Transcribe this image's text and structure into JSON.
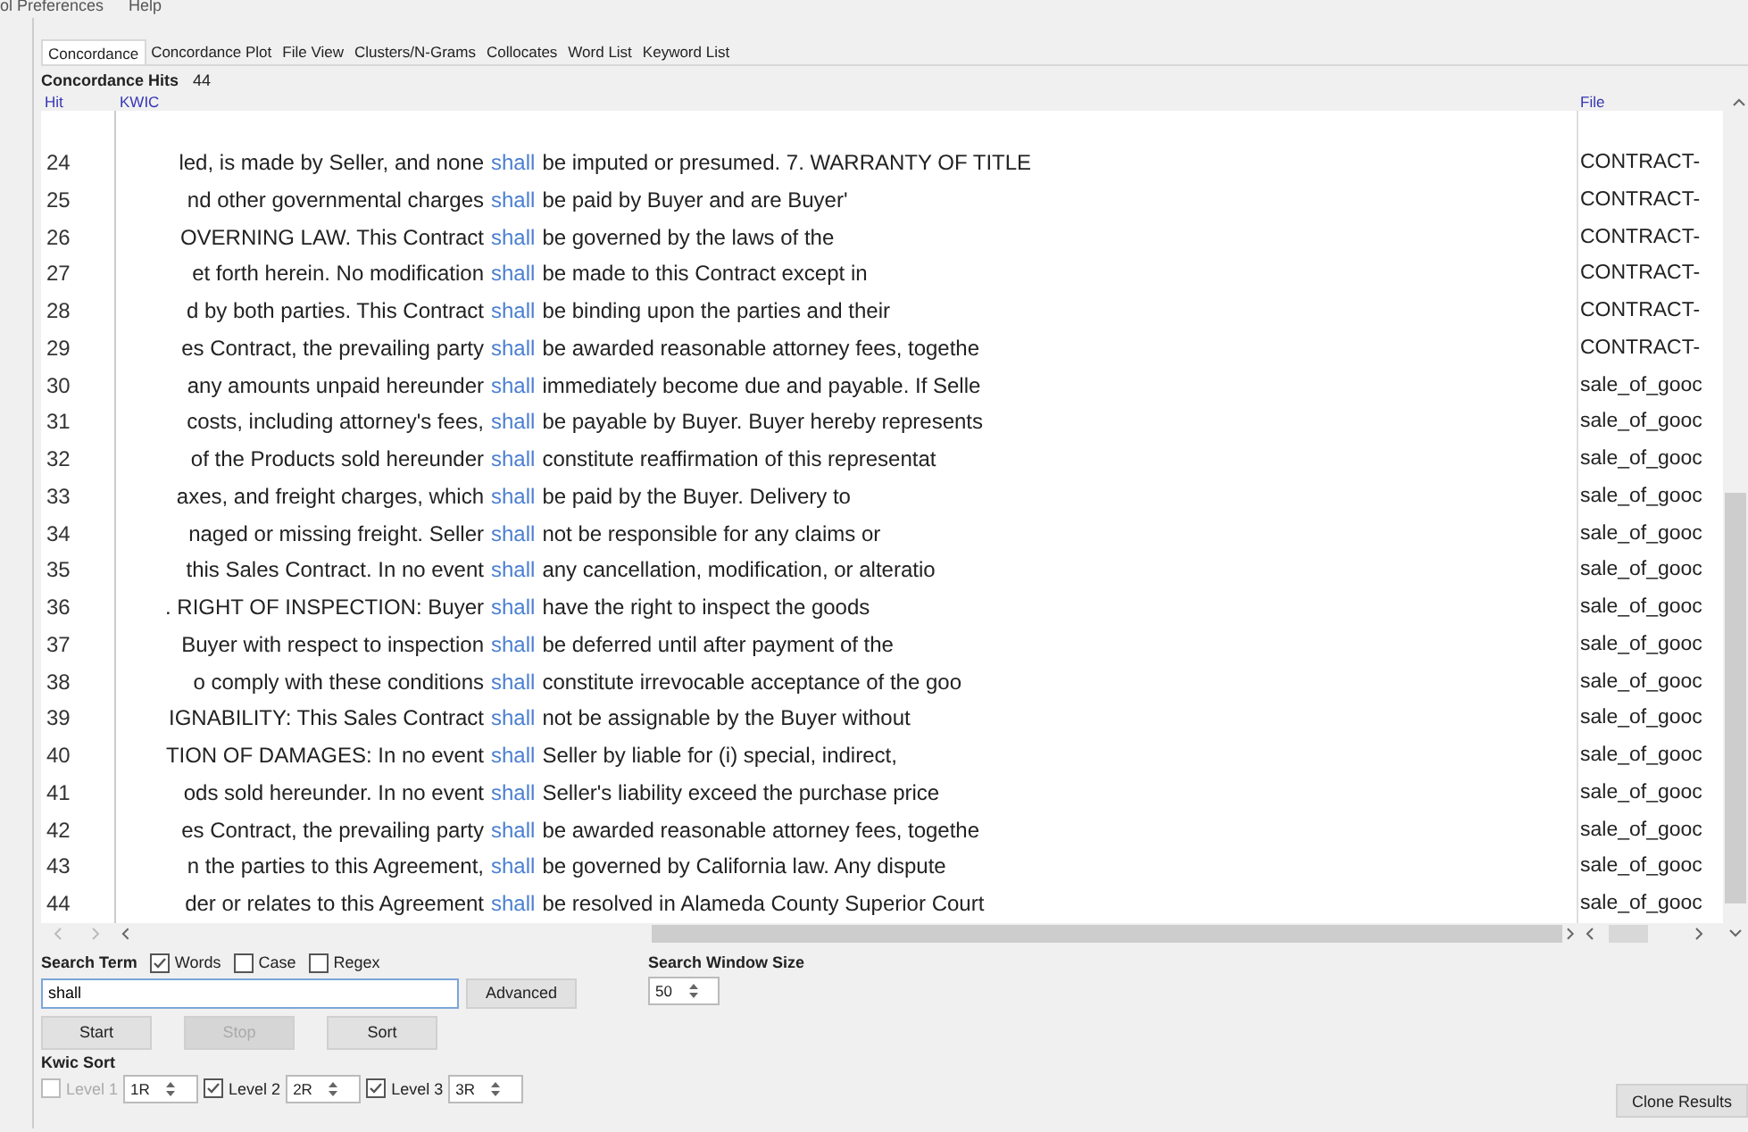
{
  "menu": [
    "ol Preferences",
    "Help"
  ],
  "tabs": [
    {
      "label": "Concordance",
      "selected": true
    },
    {
      "label": "Concordance Plot",
      "selected": false
    },
    {
      "label": "File View",
      "selected": false
    },
    {
      "label": "Clusters/N-Grams",
      "selected": false
    },
    {
      "label": "Collocates",
      "selected": false
    },
    {
      "label": "Word List",
      "selected": false
    },
    {
      "label": "Keyword List",
      "selected": false
    }
  ],
  "hits_label": "Concordance Hits",
  "hits_count": "44",
  "columns": {
    "hit": "Hit",
    "kwic": "KWIC",
    "file": "File"
  },
  "rows": [
    {
      "hit": "24",
      "left": "led, is made by Seller, and none",
      "keyword": "shall",
      "right": "be imputed or presumed. 7. WARRANTY OF TITLE",
      "file": "CONTRACT-"
    },
    {
      "hit": "25",
      "left": "nd other governmental charges",
      "keyword": "shall",
      "right": "be paid by Buyer and are Buyer'",
      "file": "CONTRACT-"
    },
    {
      "hit": "26",
      "left": "OVERNING LAW. This Contract",
      "keyword": "shall",
      "right": "be governed by the laws of the",
      "file": "CONTRACT-"
    },
    {
      "hit": "27",
      "left": "et forth herein. No modification",
      "keyword": "shall",
      "right": "be made to this Contract except in",
      "file": "CONTRACT-"
    },
    {
      "hit": "28",
      "left": "d by both parties. This Contract",
      "keyword": "shall",
      "right": "be binding upon the parties and their",
      "file": "CONTRACT-"
    },
    {
      "hit": "29",
      "left": "es Contract, the prevailing party",
      "keyword": "shall",
      "right": "be awarded reasonable attorney fees, togethe",
      "file": "CONTRACT-"
    },
    {
      "hit": "30",
      "left": "any amounts unpaid hereunder",
      "keyword": "shall",
      "right": "immediately become due and payable. If Selle",
      "file": "sale_of_gooc"
    },
    {
      "hit": "31",
      "left": "costs, including attorney's fees,",
      "keyword": "shall",
      "right": "be payable by Buyer. Buyer hereby represents",
      "file": "sale_of_gooc"
    },
    {
      "hit": "32",
      "left": "of the Products sold hereunder",
      "keyword": "shall",
      "right": "constitute reaffirmation of this representat",
      "file": "sale_of_gooc"
    },
    {
      "hit": "33",
      "left": "axes, and freight charges, which",
      "keyword": "shall",
      "right": "be paid by the Buyer. Delivery to",
      "file": "sale_of_gooc"
    },
    {
      "hit": "34",
      "left": "naged or missing freight. Seller",
      "keyword": "shall",
      "right": "not be responsible for any claims or",
      "file": "sale_of_gooc"
    },
    {
      "hit": "35",
      "left": "this Sales Contract. In no event",
      "keyword": "shall",
      "right": "any cancellation, modification, or alteratio",
      "file": "sale_of_gooc"
    },
    {
      "hit": "36",
      "left": ". RIGHT OF INSPECTION: Buyer",
      "keyword": "shall",
      "right": "have the right to inspect the goods",
      "file": "sale_of_gooc"
    },
    {
      "hit": "37",
      "left": "Buyer with respect to inspection",
      "keyword": "shall",
      "right": "be deferred until after payment of the",
      "file": "sale_of_gooc"
    },
    {
      "hit": "38",
      "left": "o comply with these conditions",
      "keyword": "shall",
      "right": "constitute irrevocable acceptance of the goo",
      "file": "sale_of_gooc"
    },
    {
      "hit": "39",
      "left": "IGNABILITY: This Sales Contract",
      "keyword": "shall",
      "right": "not be assignable by the Buyer without",
      "file": "sale_of_gooc"
    },
    {
      "hit": "40",
      "left": "TION OF DAMAGES: In no event",
      "keyword": "shall",
      "right": "Seller by liable for (i) special, indirect,",
      "file": "sale_of_gooc"
    },
    {
      "hit": "41",
      "left": "ods sold hereunder. In no event",
      "keyword": "shall",
      "right": "Seller's liability exceed the purchase price",
      "file": "sale_of_gooc"
    },
    {
      "hit": "42",
      "left": "es Contract, the prevailing party",
      "keyword": "shall",
      "right": "be awarded reasonable attorney fees, togethe",
      "file": "sale_of_gooc"
    },
    {
      "hit": "43",
      "left": "n the parties to this Agreement,",
      "keyword": "shall",
      "right": "be governed by California law. Any dispute",
      "file": "sale_of_gooc"
    },
    {
      "hit": "44",
      "left": "der or relates to this Agreement",
      "keyword": "shall",
      "right": "be resolved in Alameda County Superior Court",
      "file": "sale_of_gooc"
    }
  ],
  "search": {
    "label": "Search Term",
    "options": [
      {
        "label": "Words",
        "checked": true
      },
      {
        "label": "Case",
        "checked": false
      },
      {
        "label": "Regex",
        "checked": false
      }
    ],
    "value": "shall",
    "advanced": "Advanced",
    "window_size_label": "Search Window Size",
    "window_size": "50"
  },
  "buttons": [
    {
      "label": "Start",
      "disabled": false
    },
    {
      "label": "Stop",
      "disabled": true
    },
    {
      "label": "Sort",
      "disabled": false
    }
  ],
  "kwic_sort": {
    "label": "Kwic Sort",
    "levels": [
      {
        "label": "Level 1",
        "checked": false,
        "disabled": true,
        "value": "1R"
      },
      {
        "label": "Level 2",
        "checked": true,
        "disabled": false,
        "value": "2R"
      },
      {
        "label": "Level 3",
        "checked": true,
        "disabled": false,
        "value": "3R"
      }
    ]
  },
  "clone": "Clone Results"
}
